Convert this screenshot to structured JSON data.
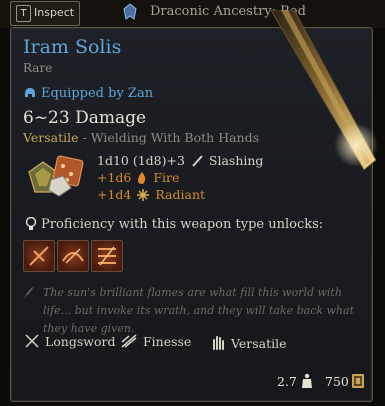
{
  "topbar": {
    "inspect_key": "T",
    "inspect_label": "Inspect",
    "ancestry_label": "Draconic Ancestry: Red"
  },
  "item": {
    "name": "Iram Solis",
    "rarity": "Rare",
    "equipped": "Equipped by Zan",
    "damage": "6~23 Damage",
    "versatile_tag": "Versatile",
    "versatile_rest": " - Wielding With Both Hands",
    "damage_rows": [
      {
        "dice": "1d10 (1d8)+3",
        "icon": "slashing-icon",
        "type": "Slashing",
        "color": "#d8d2c4"
      },
      {
        "dice": "+1d6",
        "icon": "fire-icon",
        "type": "Fire",
        "color": "#d08c30"
      },
      {
        "dice": "+1d4",
        "icon": "radiant-icon",
        "type": "Radiant",
        "color": "#d08c30"
      }
    ],
    "proficiency_text": "Proficiency with this weapon type unlocks:",
    "weapon_actions": [
      "action-icon-1",
      "action-icon-2",
      "action-icon-3"
    ],
    "lore": "The sun's brilliant flames are what fill this world with life... but invoke its wrath, and they will take back what they have given.",
    "properties": [
      {
        "icon": "longsword-icon",
        "label": "Longsword"
      },
      {
        "icon": "finesse-icon",
        "label": "Finesse"
      },
      {
        "icon": "versatile-icon",
        "label": "Versatile"
      }
    ],
    "weight": "2.7",
    "price": "750"
  },
  "colors": {
    "title": "#5fa6d8",
    "accent_gold": "#c9a55a",
    "fire_orange": "#d08c30"
  }
}
